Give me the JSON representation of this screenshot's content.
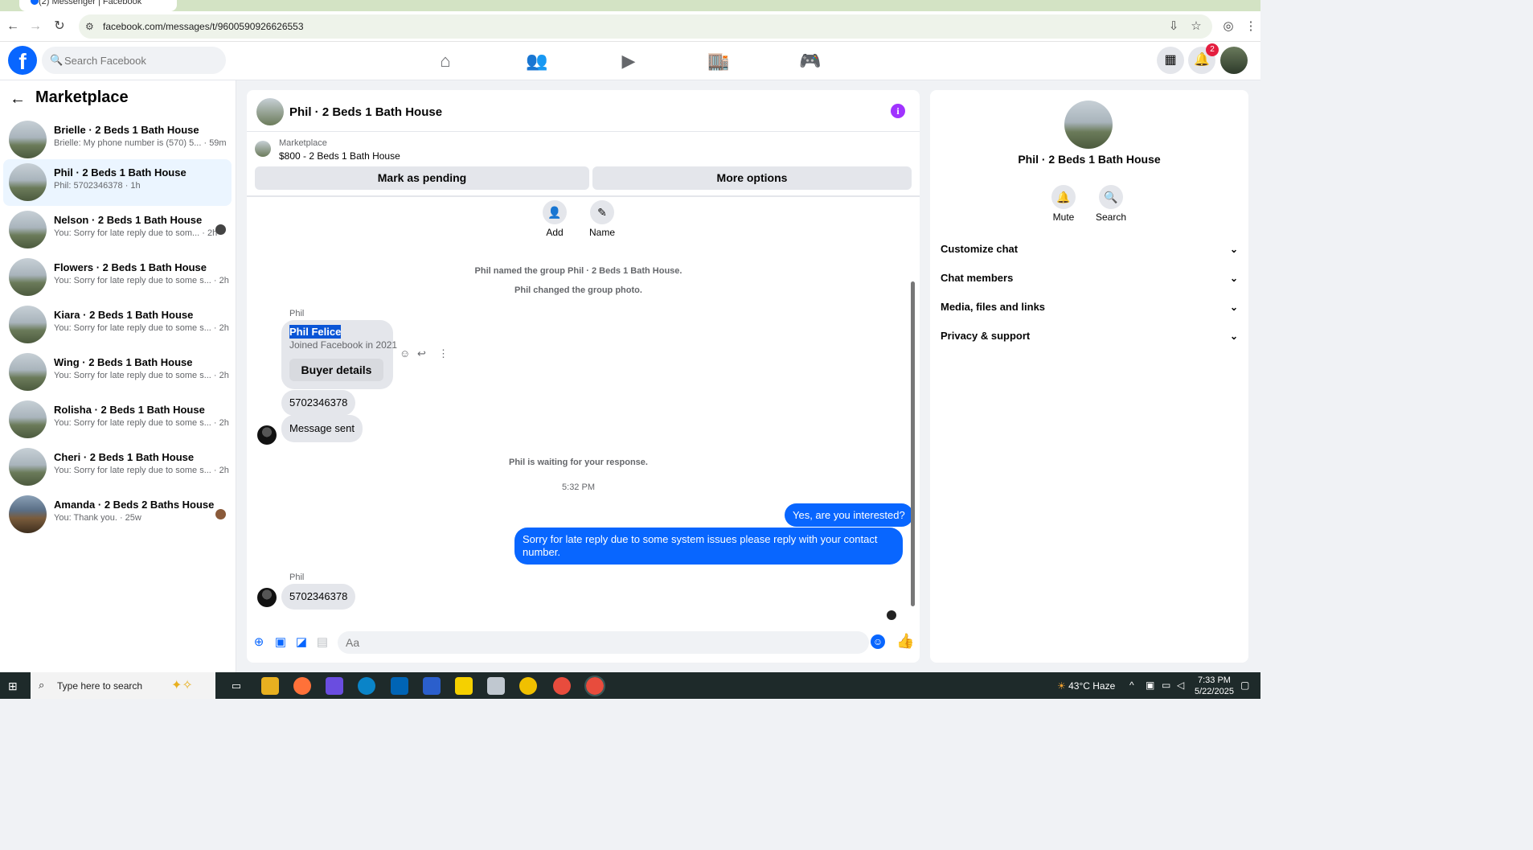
{
  "browser": {
    "tab_title": "(2) Messenger | Facebook",
    "url": "facebook.com/messages/t/9600590926626553"
  },
  "fb": {
    "search_placeholder": "Search Facebook",
    "notifications_count": "2"
  },
  "left": {
    "title": "Marketplace",
    "chats": [
      {
        "name": "Brielle · 2 Beds 1 Bath House",
        "sub": "Brielle: My phone number is (570) 5... · 59m"
      },
      {
        "name": "Phil · 2 Beds 1 Bath House",
        "sub": "Phil: 5702346378 · 1h"
      },
      {
        "name": "Nelson · 2 Beds 1 Bath House",
        "sub": "You: Sorry for late reply due to som... · 2h"
      },
      {
        "name": "Flowers · 2 Beds 1 Bath House",
        "sub": "You: Sorry for late reply due to some s... · 2h"
      },
      {
        "name": "Kiara · 2 Beds 1 Bath House",
        "sub": "You: Sorry for late reply due to some s... · 2h"
      },
      {
        "name": "Wing · 2 Beds 1 Bath House",
        "sub": "You: Sorry for late reply due to some s... · 2h"
      },
      {
        "name": "Rolisha · 2 Beds 1 Bath House",
        "sub": "You: Sorry for late reply due to some s... · 2h"
      },
      {
        "name": "Cheri · 2 Beds 1 Bath House",
        "sub": "You: Sorry for late reply due to some s... · 2h"
      },
      {
        "name": "Amanda · 2 Beds 2 Baths House",
        "sub": "You: Thank you. · 25w"
      }
    ]
  },
  "convo": {
    "title": "Phil · 2 Beds 1 Bath House",
    "marketplace_label": "Marketplace",
    "listing": "$800 - 2 Beds 1 Bath House",
    "mark_pending": "Mark as pending",
    "more_options": "More options",
    "add_label": "Add",
    "name_label": "Name",
    "sys_named": "Phil named the group Phil · 2 Beds 1 Bath House.",
    "sys_photo": "Phil changed the group photo.",
    "sender": "Phil",
    "card_name": "Phil Felice",
    "card_joined": "Joined Facebook in 2021",
    "buyer_details": "Buyer details",
    "msg_phone": "5702346378",
    "msg_sent": "Message sent",
    "sys_waiting": "Phil is waiting for your response.",
    "time": "5:32 PM",
    "out_1": "Yes, are you interested?",
    "out_2": "Sorry for late reply due to some system issues please reply with your contact number.",
    "sender2": "Phil",
    "msg_phone2": "5702346378",
    "composer_placeholder": "Aa"
  },
  "right": {
    "title": "Phil · 2 Beds 1 Bath House",
    "mute": "Mute",
    "search": "Search",
    "rows": [
      "Customize chat",
      "Chat members",
      "Media, files and links",
      "Privacy & support"
    ]
  },
  "taskbar": {
    "search_text": "Type here to search",
    "weather": "43°C  Haze",
    "time": "7:33 PM",
    "date": "5/22/2025"
  },
  "colors": {
    "accent": "#0866ff",
    "info": "#a033ff"
  }
}
